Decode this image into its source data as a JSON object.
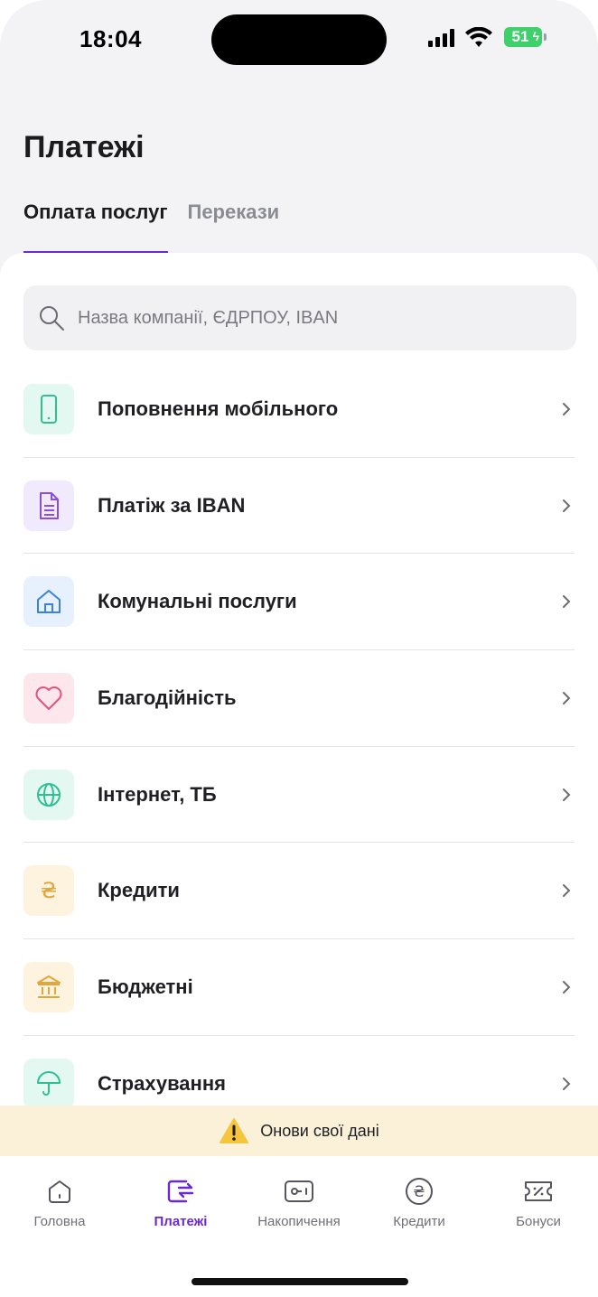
{
  "status_bar": {
    "time": "18:04",
    "battery": "51"
  },
  "header": {
    "title": "Платежі"
  },
  "tabs": [
    {
      "label": "Оплата послуг",
      "active": true
    },
    {
      "label": "Перекази",
      "active": false
    }
  ],
  "search": {
    "placeholder": "Назва компанії, ЄДРПОУ, IBAN",
    "icon": "search-icon"
  },
  "categories": [
    {
      "label": "Поповнення мобільного",
      "icon": "phone-icon",
      "bg": "#e3f8f1",
      "color": "#2fbf93"
    },
    {
      "label": "Платіж за IBAN",
      "icon": "document-icon",
      "bg": "#f1e9fc",
      "color": "#8a4de0"
    },
    {
      "label": "Комунальні послуги",
      "icon": "house-icon",
      "bg": "#e6f1fd",
      "color": "#3b82e0"
    },
    {
      "label": "Благодійність",
      "icon": "heart-icon",
      "bg": "#fde6ec",
      "color": "#e0557a"
    },
    {
      "label": "Інтернет, ТБ",
      "icon": "globe-icon",
      "bg": "#e3f8f1",
      "color": "#2fbf93"
    },
    {
      "label": "Кредити",
      "icon": "hryvnia-icon",
      "bg": "#fdf3df",
      "color": "#e2a63b"
    },
    {
      "label": "Бюджетні",
      "icon": "bank-icon",
      "bg": "#fdf3df",
      "color": "#e2a63b"
    },
    {
      "label": "Страхування",
      "icon": "umbrella-icon",
      "bg": "#e3f8f1",
      "color": "#2fbf93"
    }
  ],
  "notice": {
    "text": "Онови свої дані",
    "icon": "warning-icon"
  },
  "tabbar": [
    {
      "label": "Головна",
      "icon": "home-icon",
      "active": false
    },
    {
      "label": "Платежі",
      "icon": "transfer-icon",
      "active": true
    },
    {
      "label": "Накопичення",
      "icon": "savings-icon",
      "active": false
    },
    {
      "label": "Кредити",
      "icon": "hryvnia-circle-icon",
      "active": false
    },
    {
      "label": "Бонуси",
      "icon": "coupon-icon",
      "active": false
    }
  ],
  "colors": {
    "accent": "#6a28d8"
  }
}
